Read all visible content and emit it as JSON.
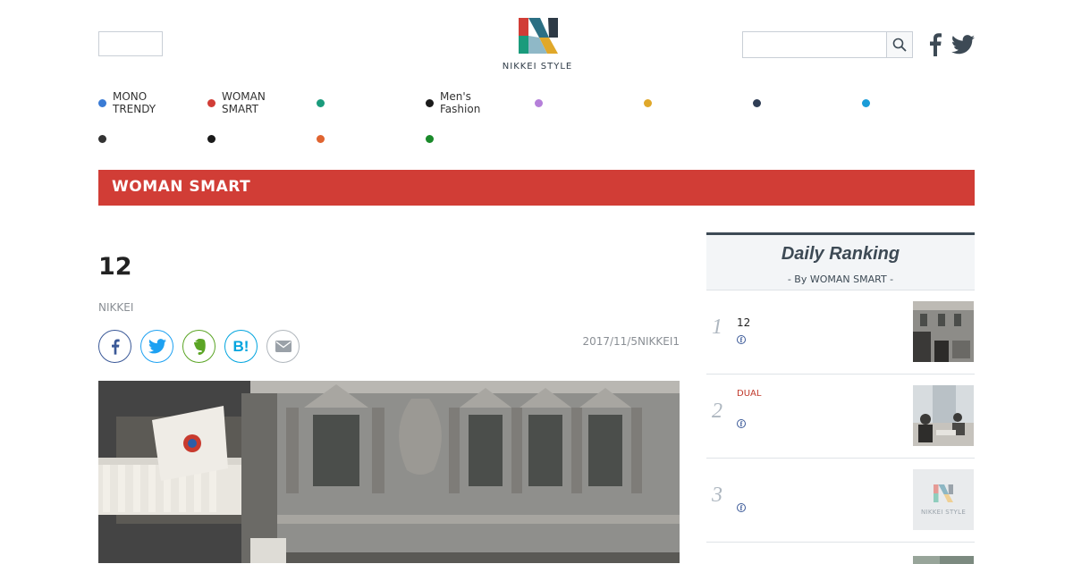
{
  "header": {
    "logo_text": "NIKKEI STYLE",
    "search": {
      "value": "",
      "placeholder": ""
    },
    "social": [
      "facebook-icon",
      "twitter-icon"
    ]
  },
  "categories": [
    {
      "label": "MONO\nTRENDY",
      "color": "#3a7bd5"
    },
    {
      "label": "WOMAN\nSMART",
      "color": "#d13d36"
    },
    {
      "label": "",
      "color": "#1a9b7c"
    },
    {
      "label": "Men's\nFashion",
      "color": "#1a1a1a"
    },
    {
      "label": "",
      "color": "#b57fd9"
    },
    {
      "label": "",
      "color": "#e0a82a"
    },
    {
      "label": "",
      "color": "#2f3d55"
    },
    {
      "label": "",
      "color": "#1a9cd8"
    },
    {
      "label": "",
      "color": "#333333"
    },
    {
      "label": "",
      "color": "#1a1a1a"
    },
    {
      "label": "",
      "color": "#e06430"
    },
    {
      "label": "",
      "color": "#1a8a2a"
    }
  ],
  "section": {
    "title": "WOMAN SMART"
  },
  "article": {
    "title": "12",
    "author": "NIKKEI",
    "date": "2017/11/5NIKKEI1",
    "share": [
      "facebook",
      "twitter",
      "evernote",
      "hatena",
      "mail"
    ]
  },
  "ranking": {
    "title": "Daily Ranking",
    "subtitle": "- By WOMAN SMART -",
    "items": [
      {
        "num": "1",
        "tag": "",
        "text": "12"
      },
      {
        "num": "2",
        "tag": "DUAL",
        "text": ""
      },
      {
        "num": "3",
        "tag": "",
        "text": "",
        "thumb_text": "NIKKEI STYLE"
      }
    ]
  },
  "colors": {
    "accent": "#d13d36",
    "navy": "#3d4a55",
    "facebook": "#3b5998",
    "twitter": "#1da1f2",
    "evernote": "#5ba525",
    "hatena": "#00a4de"
  }
}
